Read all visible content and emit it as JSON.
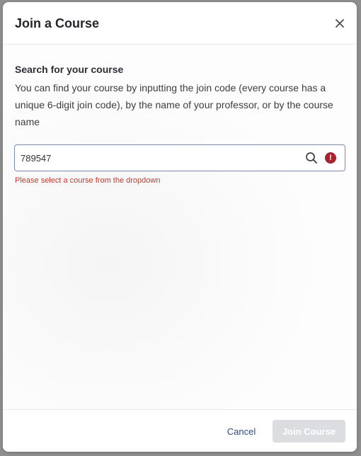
{
  "modal": {
    "title": "Join a Course",
    "close_icon": "close-icon"
  },
  "search_section": {
    "heading": "Search for your course",
    "description": "You can find your course by inputting the join code (every course has a unique 6-digit join code), by the name of your professor, or by the course name",
    "input_value": "789547",
    "search_icon": "search-icon",
    "error_icon": "error-icon",
    "error_symbol": "!",
    "error_message": "Please select a course from the dropdown"
  },
  "footer": {
    "cancel_label": "Cancel",
    "join_label": "Join Course"
  },
  "colors": {
    "error": "#a8232f",
    "link": "#2f4a86",
    "disabled_button": "#dcdde0",
    "input_border": "#7a8db0"
  }
}
